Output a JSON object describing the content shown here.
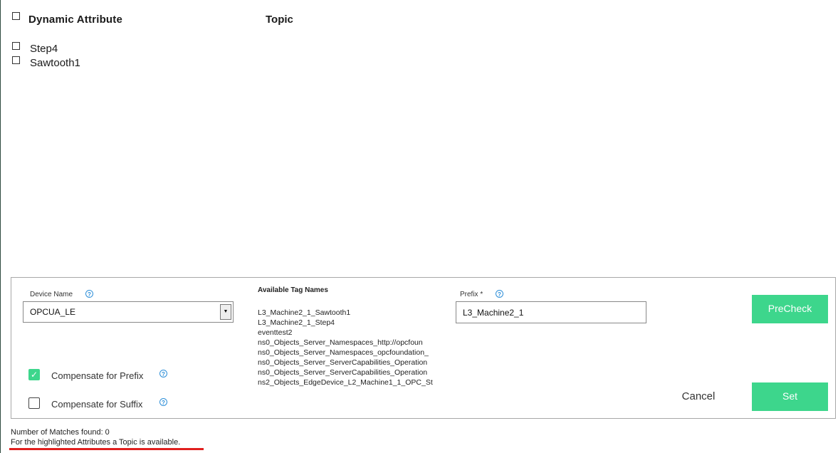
{
  "table": {
    "columns": {
      "attribute": "Dynamic Attribute",
      "topic": "Topic"
    },
    "rows": [
      {
        "label": "Step4"
      },
      {
        "label": "Sawtooth1"
      }
    ]
  },
  "form": {
    "device_name_label": "Device Name",
    "device_name_value": "OPCUA_LE",
    "available_tags_label": "Available Tag Names",
    "available_tags": [
      "L3_Machine2_1_Sawtooth1",
      "L3_Machine2_1_Step4",
      "eventtest2",
      "ns0_Objects_Server_Namespaces_http://opcfoun",
      "ns0_Objects_Server_Namespaces_opcfoundation_",
      "ns0_Objects_Server_ServerCapabilities_Operation",
      "ns0_Objects_Server_ServerCapabilities_Operation",
      "ns2_Objects_EdgeDevice_L2_Machine1_1_OPC_St"
    ],
    "prefix_label": "Prefix *",
    "prefix_value": "L3_Machine2_1",
    "precheck_label": "PreCheck",
    "compensate_prefix_label": "Compensate for Prefix",
    "compensate_prefix_checked": true,
    "compensate_suffix_label": "Compensate for Suffix",
    "compensate_suffix_checked": false,
    "cancel_label": "Cancel",
    "set_label": "Set"
  },
  "footer": {
    "matches_text": "Number of Matches found: 0",
    "hint_text": "For the highlighted Attributes a Topic is available."
  },
  "colors": {
    "accent_green": "#3dd68c",
    "help_blue": "#2e8fd8",
    "highlight_red": "#e0201f"
  },
  "icons": {
    "help": "question-circle-icon",
    "checkmark": "checkmark-icon",
    "dropdown": "triangle-down-icon"
  }
}
